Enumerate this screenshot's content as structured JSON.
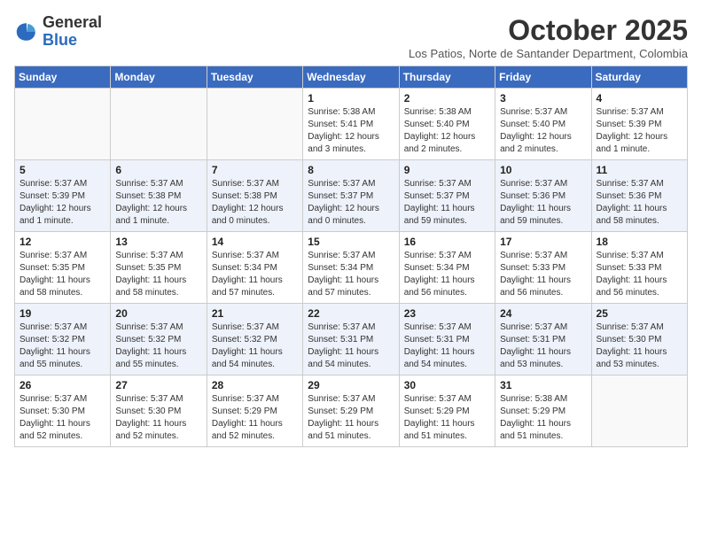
{
  "header": {
    "logo_general": "General",
    "logo_blue": "Blue",
    "month_title": "October 2025",
    "subtitle": "Los Patios, Norte de Santander Department, Colombia"
  },
  "days_of_week": [
    "Sunday",
    "Monday",
    "Tuesday",
    "Wednesday",
    "Thursday",
    "Friday",
    "Saturday"
  ],
  "weeks": [
    [
      {
        "day": "",
        "info": ""
      },
      {
        "day": "",
        "info": ""
      },
      {
        "day": "",
        "info": ""
      },
      {
        "day": "1",
        "info": "Sunrise: 5:38 AM\nSunset: 5:41 PM\nDaylight: 12 hours and 3 minutes."
      },
      {
        "day": "2",
        "info": "Sunrise: 5:38 AM\nSunset: 5:40 PM\nDaylight: 12 hours and 2 minutes."
      },
      {
        "day": "3",
        "info": "Sunrise: 5:37 AM\nSunset: 5:40 PM\nDaylight: 12 hours and 2 minutes."
      },
      {
        "day": "4",
        "info": "Sunrise: 5:37 AM\nSunset: 5:39 PM\nDaylight: 12 hours and 1 minute."
      }
    ],
    [
      {
        "day": "5",
        "info": "Sunrise: 5:37 AM\nSunset: 5:39 PM\nDaylight: 12 hours and 1 minute."
      },
      {
        "day": "6",
        "info": "Sunrise: 5:37 AM\nSunset: 5:38 PM\nDaylight: 12 hours and 1 minute."
      },
      {
        "day": "7",
        "info": "Sunrise: 5:37 AM\nSunset: 5:38 PM\nDaylight: 12 hours and 0 minutes."
      },
      {
        "day": "8",
        "info": "Sunrise: 5:37 AM\nSunset: 5:37 PM\nDaylight: 12 hours and 0 minutes."
      },
      {
        "day": "9",
        "info": "Sunrise: 5:37 AM\nSunset: 5:37 PM\nDaylight: 11 hours and 59 minutes."
      },
      {
        "day": "10",
        "info": "Sunrise: 5:37 AM\nSunset: 5:36 PM\nDaylight: 11 hours and 59 minutes."
      },
      {
        "day": "11",
        "info": "Sunrise: 5:37 AM\nSunset: 5:36 PM\nDaylight: 11 hours and 58 minutes."
      }
    ],
    [
      {
        "day": "12",
        "info": "Sunrise: 5:37 AM\nSunset: 5:35 PM\nDaylight: 11 hours and 58 minutes."
      },
      {
        "day": "13",
        "info": "Sunrise: 5:37 AM\nSunset: 5:35 PM\nDaylight: 11 hours and 58 minutes."
      },
      {
        "day": "14",
        "info": "Sunrise: 5:37 AM\nSunset: 5:34 PM\nDaylight: 11 hours and 57 minutes."
      },
      {
        "day": "15",
        "info": "Sunrise: 5:37 AM\nSunset: 5:34 PM\nDaylight: 11 hours and 57 minutes."
      },
      {
        "day": "16",
        "info": "Sunrise: 5:37 AM\nSunset: 5:34 PM\nDaylight: 11 hours and 56 minutes."
      },
      {
        "day": "17",
        "info": "Sunrise: 5:37 AM\nSunset: 5:33 PM\nDaylight: 11 hours and 56 minutes."
      },
      {
        "day": "18",
        "info": "Sunrise: 5:37 AM\nSunset: 5:33 PM\nDaylight: 11 hours and 56 minutes."
      }
    ],
    [
      {
        "day": "19",
        "info": "Sunrise: 5:37 AM\nSunset: 5:32 PM\nDaylight: 11 hours and 55 minutes."
      },
      {
        "day": "20",
        "info": "Sunrise: 5:37 AM\nSunset: 5:32 PM\nDaylight: 11 hours and 55 minutes."
      },
      {
        "day": "21",
        "info": "Sunrise: 5:37 AM\nSunset: 5:32 PM\nDaylight: 11 hours and 54 minutes."
      },
      {
        "day": "22",
        "info": "Sunrise: 5:37 AM\nSunset: 5:31 PM\nDaylight: 11 hours and 54 minutes."
      },
      {
        "day": "23",
        "info": "Sunrise: 5:37 AM\nSunset: 5:31 PM\nDaylight: 11 hours and 54 minutes."
      },
      {
        "day": "24",
        "info": "Sunrise: 5:37 AM\nSunset: 5:31 PM\nDaylight: 11 hours and 53 minutes."
      },
      {
        "day": "25",
        "info": "Sunrise: 5:37 AM\nSunset: 5:30 PM\nDaylight: 11 hours and 53 minutes."
      }
    ],
    [
      {
        "day": "26",
        "info": "Sunrise: 5:37 AM\nSunset: 5:30 PM\nDaylight: 11 hours and 52 minutes."
      },
      {
        "day": "27",
        "info": "Sunrise: 5:37 AM\nSunset: 5:30 PM\nDaylight: 11 hours and 52 minutes."
      },
      {
        "day": "28",
        "info": "Sunrise: 5:37 AM\nSunset: 5:29 PM\nDaylight: 11 hours and 52 minutes."
      },
      {
        "day": "29",
        "info": "Sunrise: 5:37 AM\nSunset: 5:29 PM\nDaylight: 11 hours and 51 minutes."
      },
      {
        "day": "30",
        "info": "Sunrise: 5:37 AM\nSunset: 5:29 PM\nDaylight: 11 hours and 51 minutes."
      },
      {
        "day": "31",
        "info": "Sunrise: 5:38 AM\nSunset: 5:29 PM\nDaylight: 11 hours and 51 minutes."
      },
      {
        "day": "",
        "info": ""
      }
    ]
  ]
}
